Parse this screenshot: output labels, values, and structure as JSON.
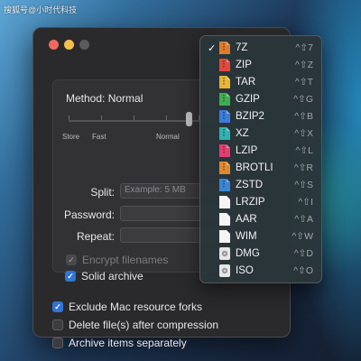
{
  "watermark": "搜狐号@小时代科技",
  "window": {
    "method_label": "Method: Normal",
    "compression_slider": {
      "level_fraction": 0.74,
      "tick_labels": [
        "Store",
        "Fast",
        "Normal"
      ]
    },
    "fields": {
      "split_label": "Split:",
      "split_placeholder": "Example: 5 MB",
      "password_label": "Password:",
      "repeat_label": "Repeat:"
    },
    "options": {
      "encrypt_filenames": {
        "label": "Encrypt filenames",
        "checked": true,
        "enabled": false
      },
      "solid_archive": {
        "label": "Solid archive",
        "checked": true,
        "enabled": true
      }
    },
    "bottom_options": [
      {
        "label": "Exclude Mac resource forks",
        "checked": true
      },
      {
        "label": "Delete file(s) after compression",
        "checked": false
      },
      {
        "label": "Archive items separately",
        "checked": false
      }
    ]
  },
  "format_menu": {
    "selected": "7Z",
    "items": [
      {
        "label": "7Z",
        "shortcut": "^⇧7",
        "icon": "7z-archive-icon",
        "color": "#e07b2c"
      },
      {
        "label": "ZIP",
        "shortcut": "^⇧Z",
        "icon": "zip-archive-icon",
        "color": "#e04a3c"
      },
      {
        "label": "TAR",
        "shortcut": "^⇧T",
        "icon": "tar-archive-icon",
        "color": "#e9b43a"
      },
      {
        "label": "GZIP",
        "shortcut": "^⇧G",
        "icon": "gzip-archive-icon",
        "color": "#3fae4f"
      },
      {
        "label": "BZIP2",
        "shortcut": "^⇧B",
        "icon": "bzip2-archive-icon",
        "color": "#3b7ddb"
      },
      {
        "label": "XZ",
        "shortcut": "^⇧X",
        "icon": "xz-archive-icon",
        "color": "#2fb3b0"
      },
      {
        "label": "LZIP",
        "shortcut": "^⇧L",
        "icon": "lzip-archive-icon",
        "color": "#e0406e"
      },
      {
        "label": "BROTLI",
        "shortcut": "^⇧R",
        "icon": "brotli-archive-icon",
        "color": "#e08a2c"
      },
      {
        "label": "ZSTD",
        "shortcut": "^⇧S",
        "icon": "zstd-archive-icon",
        "color": "#3a86d6"
      },
      {
        "label": "LRZIP",
        "shortcut": "^⇧I",
        "icon": "lrzip-file-icon",
        "color": "#f4f4f4"
      },
      {
        "label": "AAR",
        "shortcut": "^⇧A",
        "icon": "aar-file-icon",
        "color": "#f4f4f4"
      },
      {
        "label": "WIM",
        "shortcut": "^⇧W",
        "icon": "wim-file-icon",
        "color": "#f4f4f4"
      },
      {
        "label": "DMG",
        "shortcut": "^⇧D",
        "icon": "dmg-disk-image-icon",
        "color": "#e6e6e6"
      },
      {
        "label": "ISO",
        "shortcut": "^⇧O",
        "icon": "iso-disk-image-icon",
        "color": "#e6e6e6"
      }
    ]
  }
}
